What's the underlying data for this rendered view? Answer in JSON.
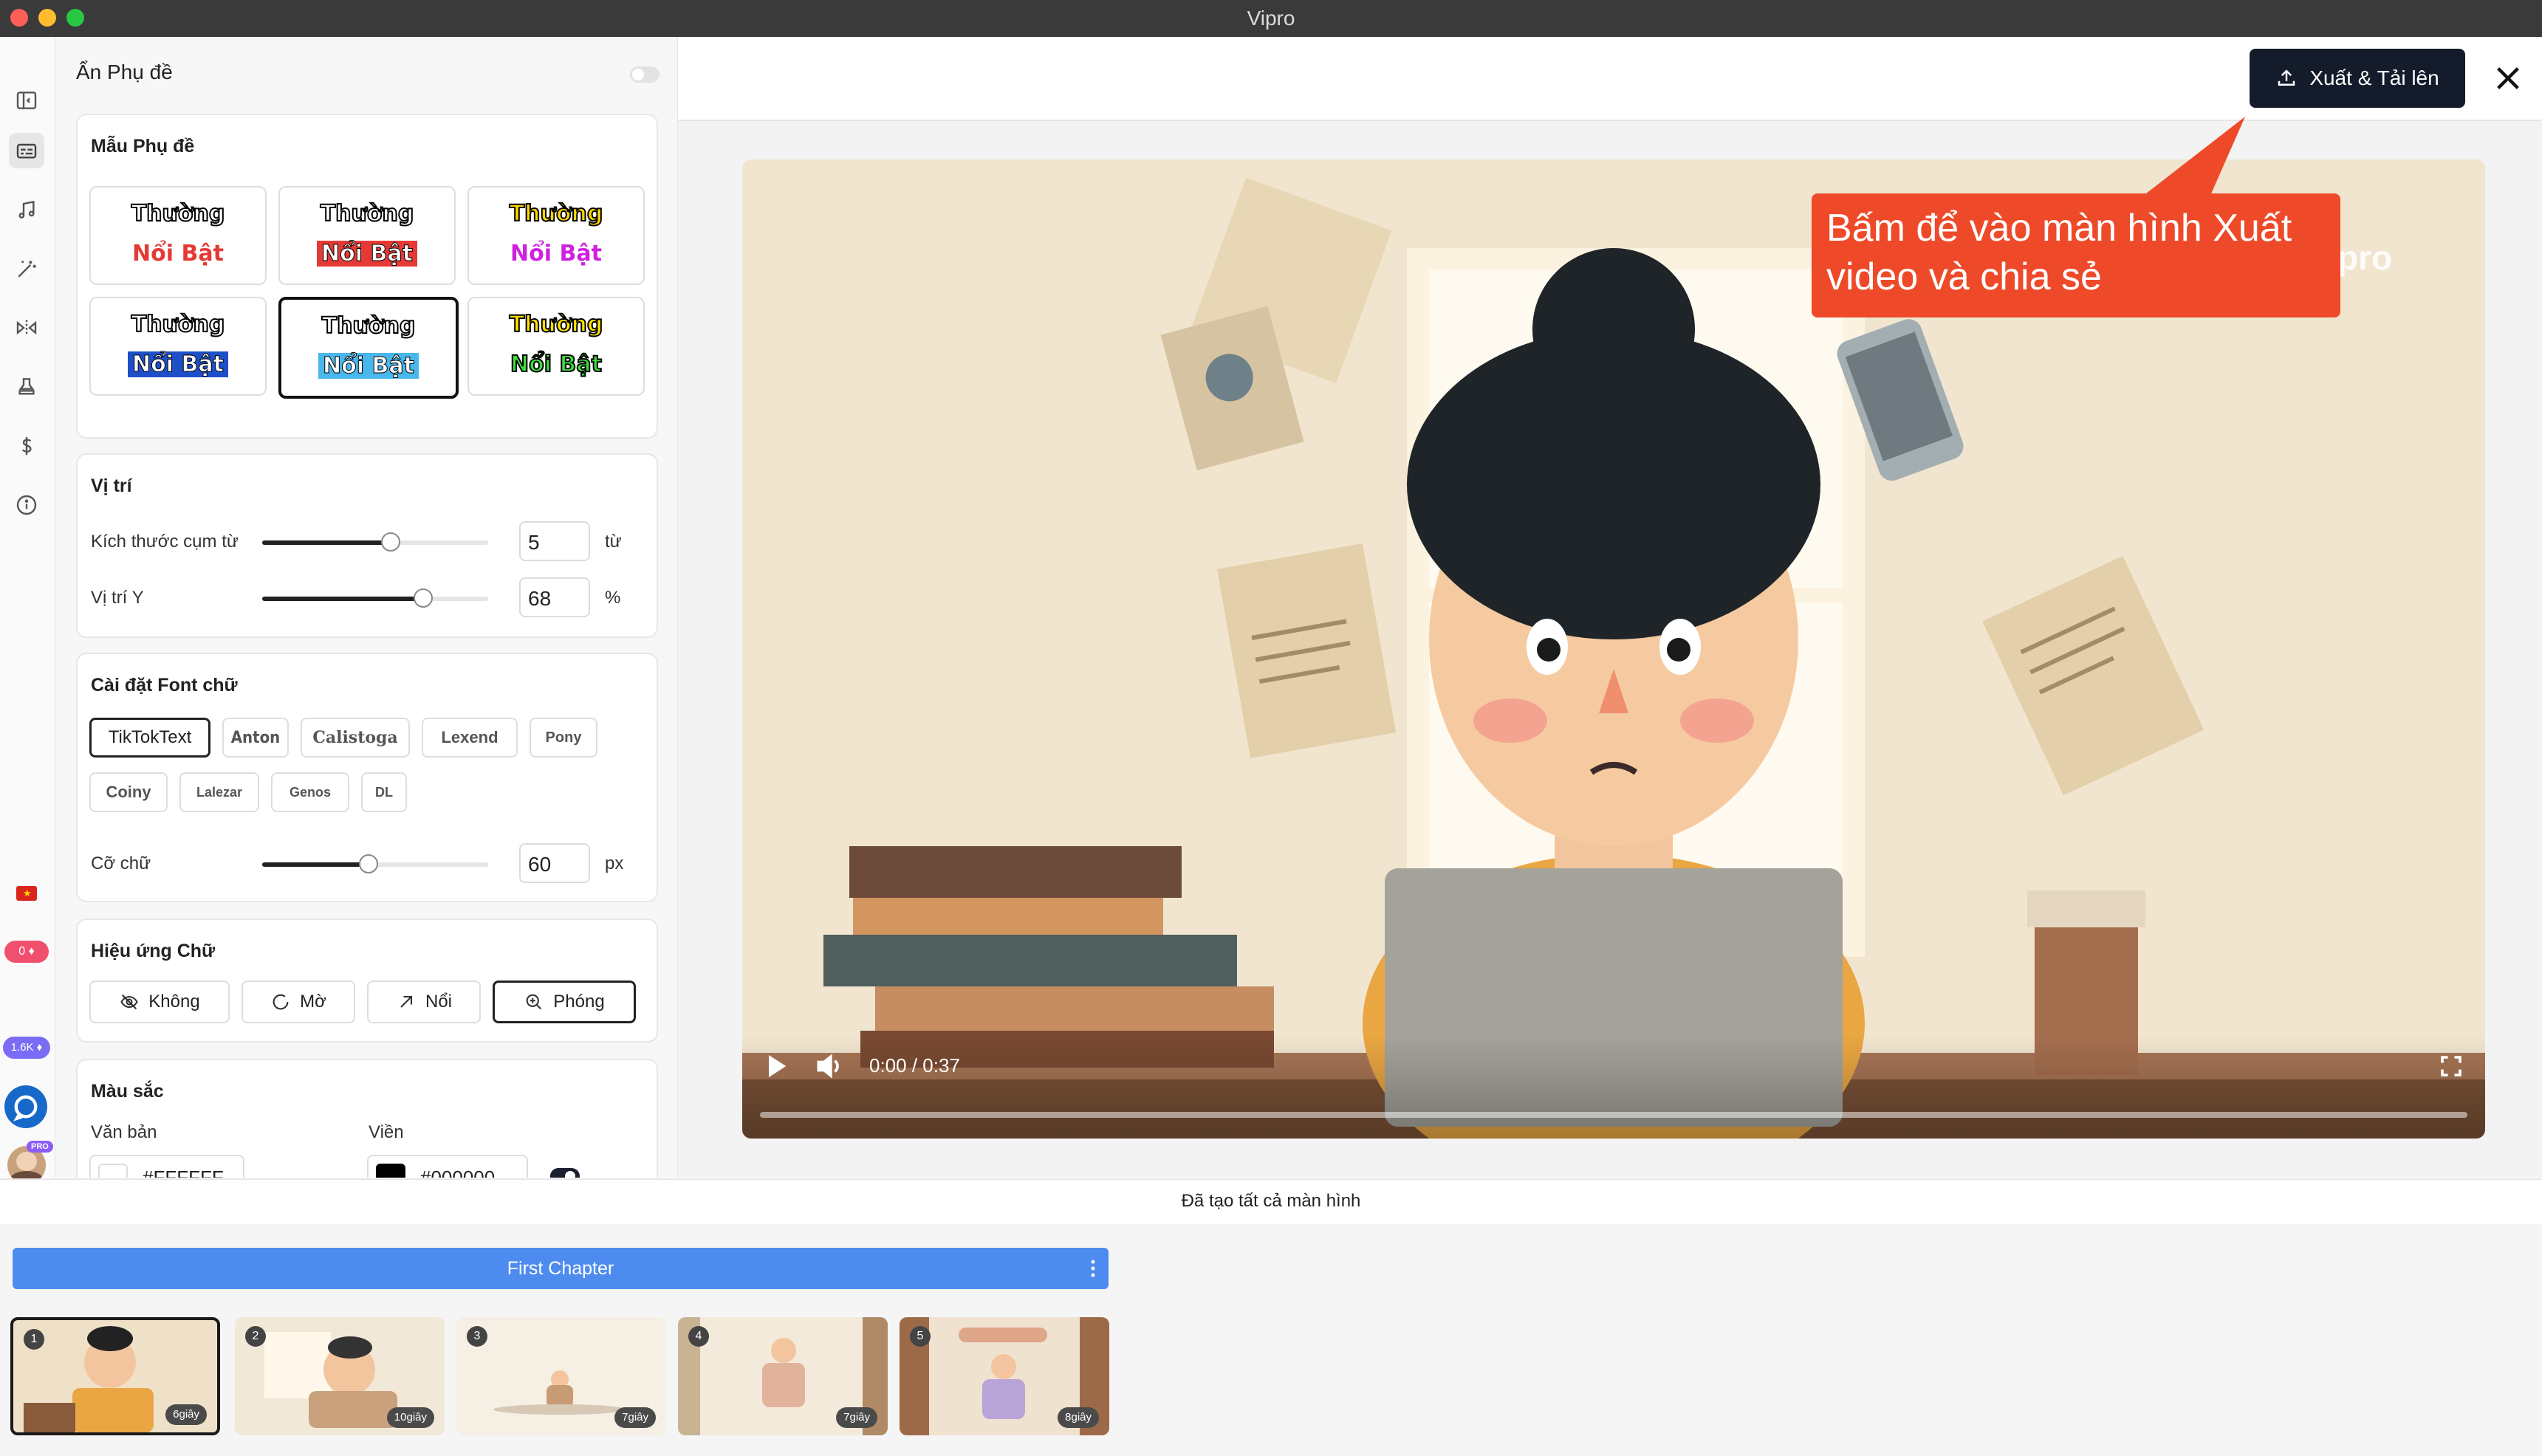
{
  "window": {
    "title": "Vipro"
  },
  "sidebar": {
    "icons": [
      "panel-collapse-icon",
      "subtitles-icon",
      "music-icon",
      "magic-wand-icon",
      "transition-icon",
      "stamp-icon",
      "dollar-icon",
      "info-icon"
    ],
    "badges": {
      "flag": "vietnam-flag-icon",
      "points": "0",
      "credits": "1.6K",
      "pro": "PRO"
    }
  },
  "panel": {
    "hide_subtitles_label": "Ẩn Phụ đề",
    "templates": {
      "title": "Mẫu Phụ đề",
      "items": [
        {
          "normal": "Thường",
          "highlight": "Nổi Bật",
          "normal_color": "#ffffff",
          "highlight_color": "#e53935"
        },
        {
          "normal": "Thường",
          "highlight": "Nổi Bật",
          "normal_color": "#ffffff",
          "highlight_color": "#ffffff"
        },
        {
          "normal": "Thường",
          "highlight": "Nổi Bật",
          "normal_color": "#ffd600",
          "highlight_color": "#d020e0"
        },
        {
          "normal": "Thường",
          "highlight": "Nổi Bật",
          "normal_color": "#ffffff",
          "highlight_color": "#ffffff"
        },
        {
          "normal": "Thường",
          "highlight": "Nổi Bật",
          "normal_color": "#ffffff",
          "highlight_color": "#ffffff"
        },
        {
          "normal": "Thường",
          "highlight": "Nổi Bật",
          "normal_color": "#ffe100",
          "highlight_color": "#3ddc3d"
        }
      ],
      "selected_index": 4
    },
    "position": {
      "title": "Vị trí",
      "word_group_label": "Kích thước cụm từ",
      "word_group_value": "5",
      "word_group_unit": "từ",
      "y_label": "Vị trí Y",
      "y_value": "68",
      "y_unit": "%"
    },
    "font": {
      "title": "Cài đặt Font chữ",
      "options": [
        "TikTokText",
        "Anton",
        "Calistoga",
        "Lexend",
        "Pony",
        "Coiny",
        "Lalezar",
        "Genos",
        "DL"
      ],
      "selected": "TikTokText",
      "size_label": "Cỡ chữ",
      "size_value": "60",
      "size_unit": "px"
    },
    "effects": {
      "title": "Hiệu ứng Chữ",
      "options": [
        "Không",
        "Mờ",
        "Nổi",
        "Phóng"
      ],
      "selected": "Phóng"
    },
    "colors": {
      "title": "Màu sắc",
      "text_label": "Văn bản",
      "text_value": "#FFFFFF",
      "outline_label": "Viền",
      "outline_value": "#000000"
    }
  },
  "toolbar": {
    "export_label": "Xuất & Tải lên"
  },
  "video": {
    "time": "0:00 / 0:37",
    "progress": 0,
    "watermark_partial": "pro"
  },
  "callout": {
    "text": "Bấm để vào màn hình Xuất video và chia sẻ"
  },
  "timeline": {
    "status": "Đã tạo tất cả màn hình",
    "chapter": "First Chapter",
    "scenes": [
      {
        "num": "1",
        "duration": "6giây"
      },
      {
        "num": "2",
        "duration": "10giây"
      },
      {
        "num": "3",
        "duration": "7giây"
      },
      {
        "num": "4",
        "duration": "7giây"
      },
      {
        "num": "5",
        "duration": "8giây"
      }
    ]
  }
}
